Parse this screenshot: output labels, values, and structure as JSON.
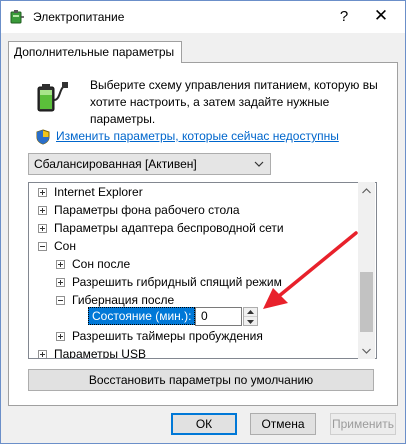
{
  "window": {
    "title": "Электропитание",
    "help_glyph": "?",
    "close_glyph": "✕"
  },
  "tab": {
    "label": "Дополнительные параметры"
  },
  "panel": {
    "description": "Выберите схему управления питанием, которую вы хотите настроить, а затем задайте нужные параметры.",
    "change_link": "Изменить параметры, которые сейчас недоступны",
    "plan_selected": "Сбалансированная [Активен]"
  },
  "tree": {
    "items": [
      {
        "label": "Internet Explorer",
        "sign": "+"
      },
      {
        "label": "Параметры фона рабочего стола",
        "sign": "+"
      },
      {
        "label": "Параметры адаптера беспроводной сети",
        "sign": "+"
      },
      {
        "label": "Сон",
        "sign": "−"
      },
      {
        "label": "Сон после",
        "sign": "+"
      },
      {
        "label": "Разрешить гибридный спящий режим",
        "sign": "+"
      },
      {
        "label": "Гибернация после",
        "sign": "−"
      },
      {
        "label": "Разрешить таймеры пробуждения",
        "sign": "+"
      },
      {
        "label": "Параметры USB",
        "sign": "+"
      }
    ],
    "edit_label": "Состояние (мин.):",
    "edit_value": "0"
  },
  "buttons": {
    "restore": "Восстановить параметры по умолчанию",
    "ok": "ОК",
    "cancel": "Отмена",
    "apply": "Применить"
  },
  "colors": {
    "accent": "#0078d7",
    "link": "#0066cc",
    "annotation_arrow": "#e8212b"
  },
  "icons": {
    "app": "power-options-icon",
    "battery": "battery-plug-icon",
    "shield": "uac-shield-icon"
  }
}
